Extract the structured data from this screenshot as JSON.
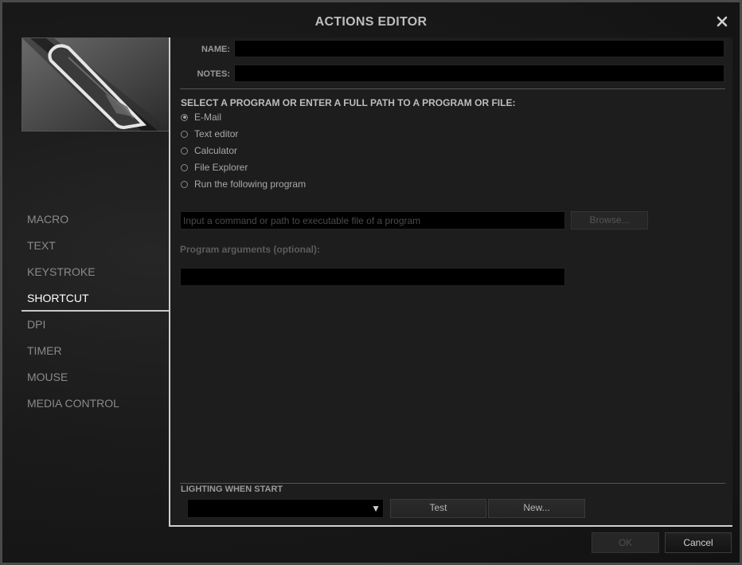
{
  "window": {
    "title": "ACTIONS EDITOR",
    "close_icon": "close-icon"
  },
  "sidebar": {
    "items": [
      {
        "label": "MACRO",
        "active": false
      },
      {
        "label": "TEXT",
        "active": false
      },
      {
        "label": "KEYSTROKE",
        "active": false
      },
      {
        "label": "SHORTCUT",
        "active": true
      },
      {
        "label": "DPI",
        "active": false
      },
      {
        "label": "TIMER",
        "active": false
      },
      {
        "label": "MOUSE",
        "active": false
      },
      {
        "label": "MEDIA CONTROL",
        "active": false
      }
    ]
  },
  "form": {
    "name_label": "NAME:",
    "name_value": "",
    "notes_label": "NOTES:",
    "notes_value": ""
  },
  "program": {
    "heading": "SELECT A PROGRAM OR ENTER A FULL PATH TO A PROGRAM OR FILE:",
    "options": [
      {
        "label": "E-Mail",
        "checked": true
      },
      {
        "label": "Text editor",
        "checked": false
      },
      {
        "label": "Calculator",
        "checked": false
      },
      {
        "label": "File Explorer",
        "checked": false
      },
      {
        "label": "Run the following program",
        "checked": false
      }
    ],
    "command_placeholder": "Input a command or path to executable file of a program",
    "command_value": "",
    "browse_label": "Browse...",
    "args_label": "Program arguments (optional):",
    "args_value": ""
  },
  "lighting": {
    "label": "LIGHTING WHEN START",
    "selected": "",
    "test_label": "Test",
    "new_label": "New..."
  },
  "footer": {
    "ok_label": "OK",
    "cancel_label": "Cancel"
  },
  "colors": {
    "background": "#1d1d1d",
    "accent_line": "#cfcfcf",
    "active_text": "#ffffff",
    "inactive_text": "#8a8a8a"
  }
}
